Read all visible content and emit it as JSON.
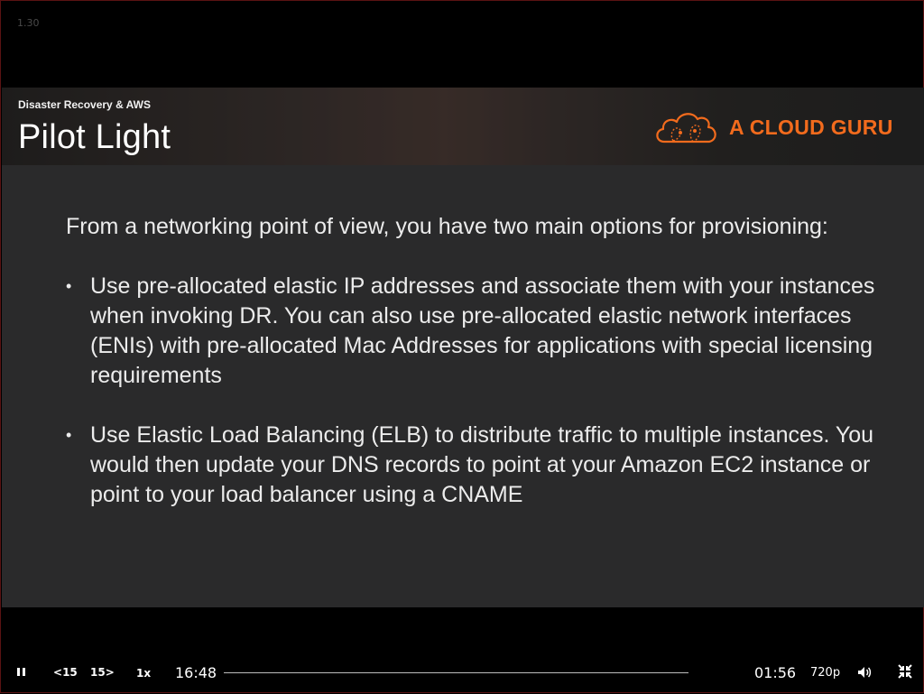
{
  "version_label": "1.30",
  "slide": {
    "course_title": "Disaster Recovery & AWS",
    "title": "Pilot Light",
    "logo_text": "A CLOUD GURU",
    "intro": "From a networking point of view, you have two main options for provisioning:",
    "bullets": [
      "Use pre-allocated elastic IP addresses and associate them with your instances when invoking DR. You can also use pre-allocated elastic network interfaces (ENIs) with pre-allocated Mac Addresses for applications with special licensing requirements",
      "Use Elastic Load Balancing (ELB) to distribute traffic to multiple instances. You would then update your DNS records to point at your Amazon EC2 instance or point to your load balancer using a CNAME"
    ],
    "bullet_marker": "•"
  },
  "player": {
    "rewind_label": "15",
    "forward_label": "15",
    "speed_label": "1x",
    "elapsed": "16:48",
    "remaining": "01:56",
    "quality": "720p",
    "progress_fraction": 0.0
  },
  "colors": {
    "brand_orange": "#f26b1d",
    "slide_background": "#2a2a2b",
    "player_background": "#000000"
  },
  "icons": {
    "pause": "pause-icon",
    "rewind": "rewind-15-icon",
    "forward": "forward-15-icon",
    "volume": "volume-icon",
    "fullscreen": "exit-fullscreen-icon",
    "logo": "cloud-logo-icon"
  }
}
